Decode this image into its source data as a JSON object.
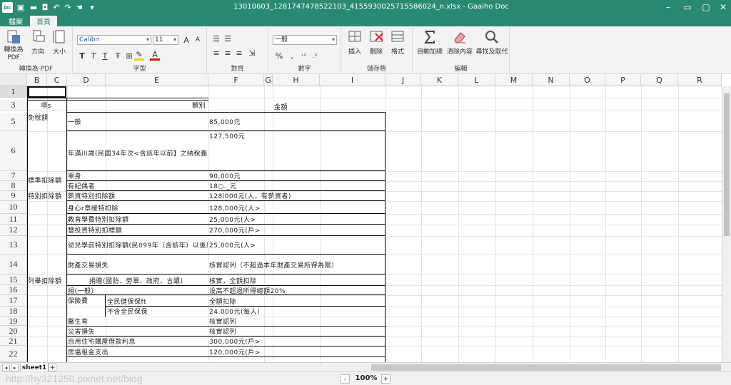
{
  "window": {
    "title": "13010603_1281747478522103_4155930025715586024_n.xlsx - Gaaiho Doc",
    "app_icon": "Dc"
  },
  "tabs": [
    {
      "label": "檔案",
      "active": false
    },
    {
      "label": "首頁",
      "active": true
    }
  ],
  "ribbon": {
    "groups": {
      "pdf": "轉換為 PDF",
      "font": "字型",
      "align": "對齊",
      "number": "數字",
      "cells": "儲存格",
      "edit": "編輯"
    },
    "buttons": {
      "to_pdf": "轉換為 PDF",
      "orientation": "方向",
      "size": "大小",
      "insert": "插入",
      "delete": "刪除",
      "format": "格式",
      "autosum": "自動加總",
      "clear": "清除內容",
      "find": "尋找及取代"
    },
    "font_name": "Calibri",
    "font_size": "11",
    "number_format": "一般",
    "percent": "%",
    "comma": ","
  },
  "columns": [
    "B",
    "C",
    "D",
    "E",
    "F",
    "G",
    "H",
    "I",
    "J",
    "K",
    "L",
    "M",
    "N",
    "O",
    "P",
    "Q",
    "R"
  ],
  "rows": [
    "1",
    "3",
    "5",
    "6",
    "7",
    "8",
    "9",
    "10",
    "11",
    "12",
    "13",
    "14",
    "15",
    "16",
    "17",
    "18",
    "19",
    "20",
    "21",
    "22"
  ],
  "cells": {
    "hdr_item": "項s",
    "hdr_category": "類別",
    "hdr_amount": "金額",
    "r5_b": "免稅額",
    "r5_d": "一般",
    "r5_f": "85,000元",
    "r6_f": "127,500元",
    "r6_d": "年滿川歲(民國34年次<含該年以前】之納稅義",
    "r7_b": "標準扣除額",
    "r7_d": "單身",
    "r7_f": "90,000元",
    "r8_d": "有紀偶者",
    "r8_f": "18○._元",
    "r9_b": "特別扣除額",
    "r9_d": "薪資特別扣除額",
    "r9_f": "128i000元(人，有薪資者)",
    "r10_d": "身心r章緩特扣除",
    "r10_f": "128,000元(人>",
    "r11_d": "教育學費特別扣除額",
    "r11_f": "25,000元(人>",
    "r12_d": "簪投資特別扣標額",
    "r12_f": "270,000元(戶>",
    "r13_d": "幼兒學前特別扣除額(民099年（含該年）以後出",
    "r13_f": "25,000元(人>",
    "r14_d": "財產交易損失",
    "r14_f": "核實認列（不超過本年財產交易所得為限）",
    "r15_b": "列舉扣除額",
    "r15_d": "捐贈(國防、勞軍、政府、古蹟)",
    "r15_f": "核實，全額扣除",
    "r16_d": "捐(一般）",
    "r16_f": "设高不超過所得總額20%",
    "r17_d": "保險費",
    "r17_e": "全民健保保ft",
    "r17_f": "全額扣除",
    "r18_e": "不含全民保保",
    "r18_f": "24.000元(每人)",
    "r19_d": "醫生育",
    "r19_f": "核實認列",
    "r20_d": "災害損失",
    "r20_f": "核實認列",
    "r21_d": "自用住宅購屋借款利息",
    "r21_f": "300,000元(戶>",
    "r22_d": "房塭租金支出",
    "r22_f": "120,000元(戶>"
  },
  "sheet": {
    "name": "sheet1",
    "add": "+"
  },
  "status": {
    "zoom": "100%",
    "minus": "-",
    "plus": "+"
  },
  "watermark": "http://hy321250.pixnet.net/blog"
}
